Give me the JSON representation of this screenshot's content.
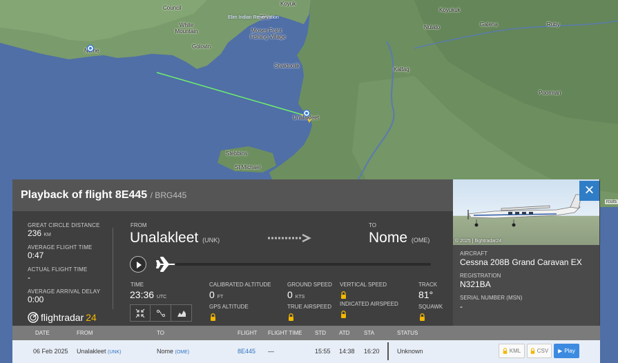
{
  "map": {
    "places": [
      "Koyuk",
      "Koyukuk",
      "Council",
      "Elim",
      "Elim Indian Reservation",
      "White Mountain",
      "Moses Point",
      "Fishing Village",
      "Galena",
      "Ruby",
      "Nome",
      "Golovin",
      "Nulato",
      "Shaktoolik",
      "Kaltag",
      "Poorman",
      "Unalakleet",
      "Stebbins",
      "St Michael"
    ],
    "attribution": "rcuts",
    "route_color": "#6ff06f",
    "land_color": "#6d8f5f",
    "water_color": "#4f6fa6"
  },
  "panel": {
    "title": "Playback of flight 8E445",
    "callsign": "/ BRG445",
    "close_icon": "×",
    "stats": {
      "great_circle_label": "GREAT CIRCLE DISTANCE",
      "great_circle_value": "236",
      "great_circle_unit": "KM",
      "avg_time_label": "AVERAGE FLIGHT TIME",
      "avg_time_value": "0:47",
      "actual_time_label": "ACTUAL FLIGHT TIME",
      "actual_time_value": "-",
      "avg_delay_label": "AVERAGE ARRIVAL DELAY",
      "avg_delay_value": "0:00"
    },
    "logo": {
      "text": "flightradar",
      "num": "24"
    },
    "route": {
      "from_label": "FROM",
      "from_city": "Unalakleet",
      "from_code": "(UNK)",
      "to_label": "TO",
      "to_city": "Nome",
      "to_code": "(OME)"
    },
    "metrics": {
      "time_label": "TIME",
      "time_value": "23:36",
      "time_unit": "UTC",
      "cal_alt_label": "CALIBRATED ALTITUDE",
      "cal_alt_value": "0",
      "cal_alt_unit": "FT",
      "gps_alt_label": "GPS ALTITUDE",
      "ground_speed_label": "GROUND SPEED",
      "ground_speed_value": "0",
      "ground_speed_unit": "KTS",
      "true_airspeed_label": "TRUE AIRSPEED",
      "vertical_speed_label": "VERTICAL SPEED",
      "indicated_airspeed_label": "INDICATED AIRSPEED",
      "track_label": "TRACK",
      "track_value": "81°",
      "squawk_label": "SQUAWK"
    },
    "playback_progress": 0.0,
    "aircraft": {
      "photo_credit": "© 2025 | flightradar24",
      "aircraft_label": "AIRCRAFT",
      "aircraft_value": "Cessna 208B Grand Caravan EX",
      "registration_label": "REGISTRATION",
      "registration_value": "N321BA",
      "serial_label": "SERIAL NUMBER (MSN)",
      "serial_value": "-"
    },
    "table": {
      "headers": [
        "DATE",
        "FROM",
        "TO",
        "FLIGHT",
        "FLIGHT TIME",
        "STD",
        "ATD",
        "STA",
        "STATUS"
      ],
      "row": {
        "date": "06 Feb 2025",
        "from": "Unalakleet",
        "from_code": "(UNK)",
        "to": "Nome",
        "to_code": "(OME)",
        "flight": "8E445",
        "flight_time": "—",
        "std": "15:55",
        "atd": "14:38",
        "sta": "16:20",
        "status": "Unknown"
      },
      "buttons": {
        "kml": "KML",
        "csv": "CSV",
        "play": "Play"
      }
    }
  }
}
